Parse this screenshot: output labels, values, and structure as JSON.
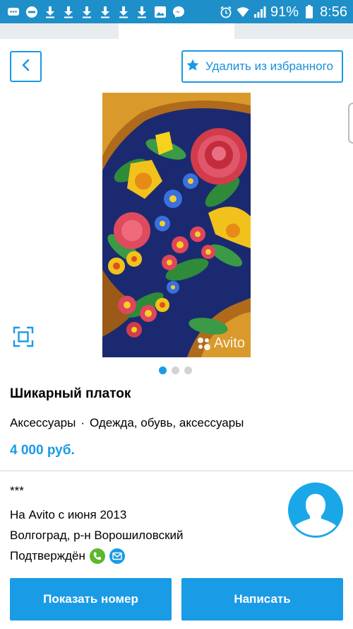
{
  "status_bar": {
    "battery": "91%",
    "time": "8:56",
    "icons": [
      "messages-icon",
      "do-not-disturb-icon",
      "download-icon",
      "download-icon",
      "download-icon",
      "download-icon",
      "download-icon",
      "download-icon",
      "image-icon",
      "messenger-icon",
      "alarm-icon",
      "wifi-icon",
      "signal-icon",
      "battery-icon"
    ]
  },
  "toolbar": {
    "back_icon": "chevron-left-icon",
    "favorite_icon": "star-icon",
    "favorite_label": "Удалить из избранного"
  },
  "gallery": {
    "watermark": "Avito",
    "total_images": 3,
    "active_index": 0
  },
  "listing": {
    "title": "Шикарный платок",
    "category": "Аксессуары",
    "separator": "·",
    "parent_category": "Одежда, обувь, аксессуары",
    "price": "4 000 руб."
  },
  "seller": {
    "name": "***",
    "since": "На Avito с июня 2013",
    "location": "Волгоград, р-н Ворошиловский",
    "verified_label": "Подтверждён",
    "verified_icons": [
      "phone-verified-icon",
      "email-verified-icon"
    ]
  },
  "actions": {
    "call_label": "Показать номер",
    "write_label": "Написать"
  },
  "colors": {
    "accent": "#1a9be6",
    "status_bar": "#1e8fc9",
    "phone_badge": "#5cb82c",
    "email_badge": "#1a9be6"
  }
}
